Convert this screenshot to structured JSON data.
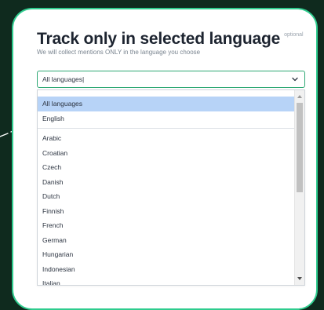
{
  "colors": {
    "background": "#0f2a1e",
    "card_border": "#2ecc8e",
    "select_border": "#2ea874",
    "selected_option": "#b7d3f7"
  },
  "panel": {
    "title": "Track only in selected language",
    "optional_badge": "optional",
    "subtitle": "We will collect mentions ONLY in the language you choose"
  },
  "select": {
    "value": "All languages",
    "icon": "chevron-down-icon"
  },
  "dropdown": {
    "selected": "All languages",
    "pinned": [
      "All languages",
      "English"
    ],
    "options": [
      "Arabic",
      "Croatian",
      "Czech",
      "Danish",
      "Dutch",
      "Finnish",
      "French",
      "German",
      "Hungarian",
      "Indonesian",
      "Italian"
    ]
  }
}
